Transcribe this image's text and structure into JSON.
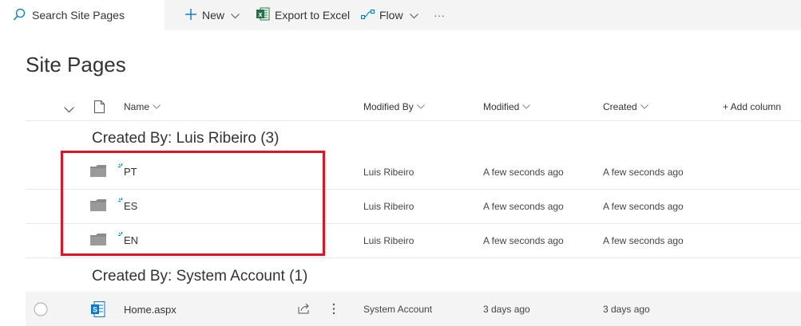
{
  "search": {
    "placeholder": "Search Site Pages"
  },
  "toolbar": {
    "new_label": "New",
    "export_label": "Export to Excel",
    "flow_label": "Flow",
    "more_label": "···"
  },
  "page": {
    "title": "Site Pages"
  },
  "columns": {
    "name": "Name",
    "modified_by": "Modified By",
    "modified": "Modified",
    "created": "Created",
    "add_column": "+ Add column"
  },
  "groups": [
    {
      "title": "Created By: Luis Ribeiro (3)",
      "rows": [
        {
          "name": "PT",
          "modified_by": "Luis Ribeiro",
          "modified": "A few seconds ago",
          "created": "A few seconds ago"
        },
        {
          "name": "ES",
          "modified_by": "Luis Ribeiro",
          "modified": "A few seconds ago",
          "created": "A few seconds ago"
        },
        {
          "name": "EN",
          "modified_by": "Luis Ribeiro",
          "modified": "A few seconds ago",
          "created": "A few seconds ago"
        }
      ]
    },
    {
      "title": "Created By: System Account (1)",
      "rows": [
        {
          "name": "Home.aspx",
          "modified_by": "System Account",
          "modified": "3 days ago",
          "created": "3 days ago"
        }
      ]
    }
  ],
  "colors": {
    "accent": "#0078d4",
    "highlight_border": "#e81123",
    "folder": "#8a8a8a",
    "excel_green": "#217346"
  }
}
